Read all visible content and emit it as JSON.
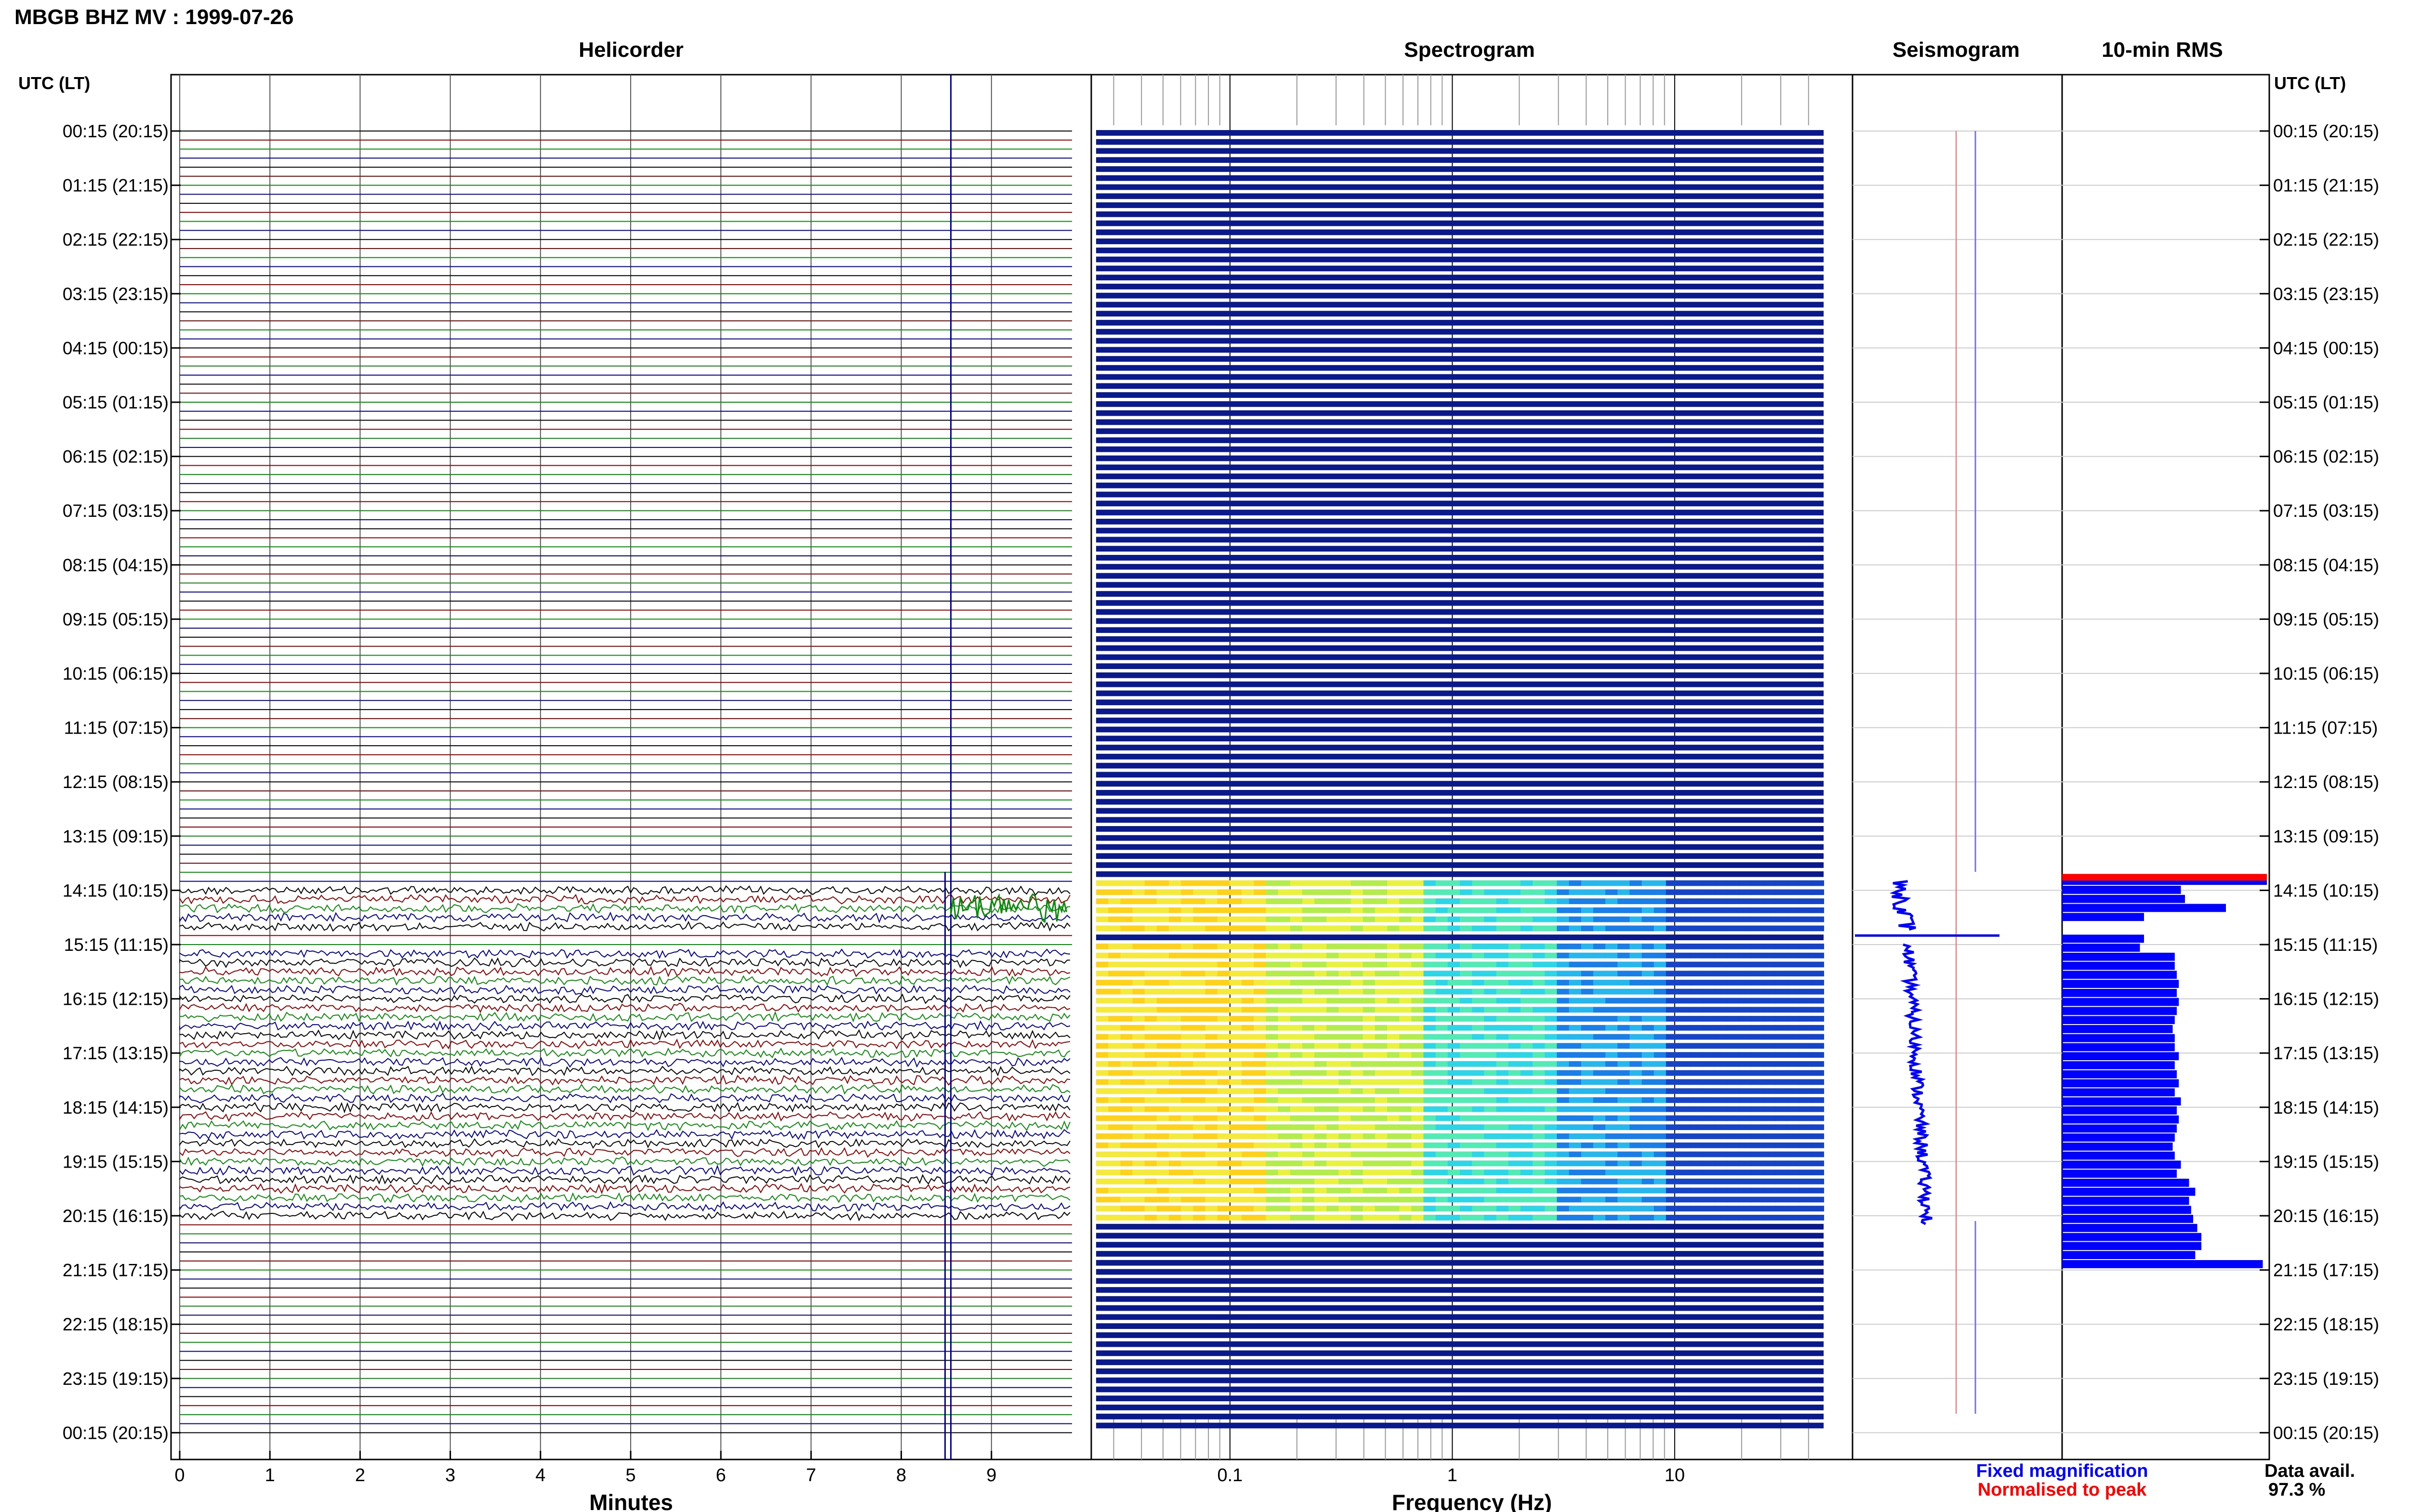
{
  "header": {
    "title": "MBGB BHZ MV : 1999-07-26"
  },
  "panels": {
    "helicorder": "Helicorder",
    "spectrogram": "Spectrogram",
    "seismogram": "Seismogram",
    "rms": "10-min RMS"
  },
  "axis": {
    "left_header": "UTC (LT)",
    "right_header": "UTC (LT)",
    "minutes_label": "Minutes",
    "frequency_label": "Frequency (Hz)"
  },
  "legend": {
    "fixed": "Fixed magnification",
    "normalised": "Normalised to peak",
    "data_avail_label": "Data avail.",
    "data_avail_value": "97.3 %"
  },
  "colors": {
    "helicorder_traces": [
      "#000000",
      "#8b0000",
      "#0a8a0a",
      "#00008b"
    ],
    "spectrogram_quiet": "#0a1a8c",
    "rms_bar": "#0000ff",
    "rms_peak": "#ff0000",
    "legend_fixed": "#0000ff",
    "legend_normalised": "#ff0000"
  },
  "chart_data": [
    {
      "type": "line",
      "panel": "Helicorder",
      "xlabel": "Minutes",
      "x_ticks": [
        "0",
        "1",
        "2",
        "3",
        "4",
        "5",
        "6",
        "7",
        "8",
        "9"
      ],
      "xlim": [
        0,
        10
      ],
      "y_ticks": [
        "00:15 (20:15)",
        "01:15 (21:15)",
        "02:15 (22:15)",
        "03:15 (23:15)",
        "04:15 (00:15)",
        "05:15 (01:15)",
        "06:15 (02:15)",
        "07:15 (03:15)",
        "08:15 (04:15)",
        "09:15 (05:15)",
        "10:15 (06:15)",
        "11:15 (07:15)",
        "12:15 (08:15)",
        "13:15 (09:15)",
        "14:15 (10:15)",
        "15:15 (11:15)",
        "16:15 (12:15)",
        "17:15 (13:15)",
        "18:15 (14:15)",
        "19:15 (15:15)",
        "20:15 (16:15)",
        "21:15 (17:15)",
        "22:15 (18:15)",
        "23:15 (19:15)",
        "00:15 (20:15)"
      ],
      "active_windows_utc": [
        [
          "14:05",
          "15:00"
        ],
        [
          "15:15",
          "20:25"
        ]
      ],
      "grid": true
    },
    {
      "type": "heatmap",
      "panel": "Spectrogram",
      "xlabel": "Frequency (Hz)",
      "x_scale": "log",
      "x_ticks": [
        "0.1",
        "1",
        "10"
      ],
      "active_windows_utc": [
        [
          "14:05",
          "15:00"
        ],
        [
          "15:15",
          "20:25"
        ]
      ]
    },
    {
      "type": "line",
      "panel": "Seismogram",
      "series": [
        {
          "name": "Fixed magnification",
          "color": "#0000ff"
        },
        {
          "name": "Normalised to peak",
          "color": "#ff0000"
        }
      ]
    },
    {
      "type": "bar",
      "panel": "10-min RMS",
      "orientation": "horizontal",
      "relative_values": [
        1.0,
        0.58,
        0.6,
        0.8,
        0.4,
        0.4,
        0.38,
        0.55,
        0.55,
        0.56,
        0.57,
        0.56,
        0.57,
        0.56,
        0.55,
        0.54,
        0.55,
        0.55,
        0.57,
        0.55,
        0.56,
        0.57,
        0.55,
        0.58,
        0.56,
        0.57,
        0.56,
        0.55,
        0.54,
        0.55,
        0.58,
        0.56,
        0.62,
        0.65,
        0.62,
        0.63,
        0.64,
        0.66,
        0.68,
        0.68,
        0.65,
        0.98
      ]
    }
  ]
}
